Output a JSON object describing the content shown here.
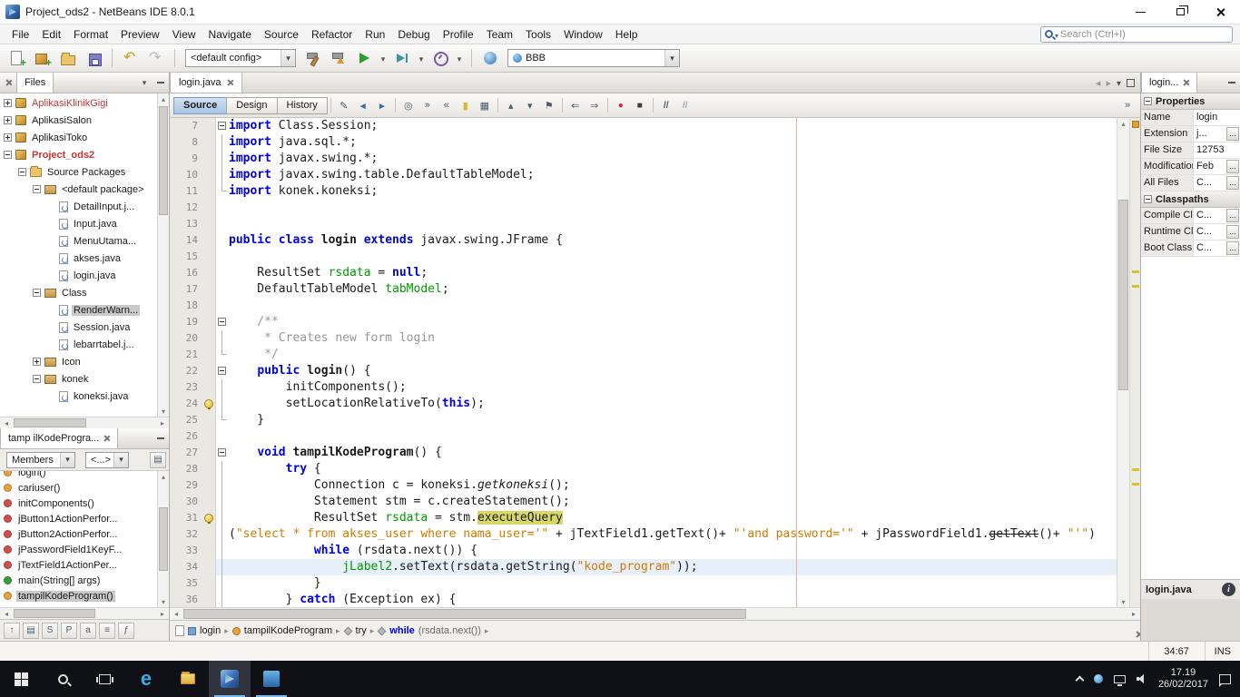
{
  "window": {
    "title": "Project_ods2 - NetBeans IDE 8.0.1"
  },
  "menubar": {
    "items": [
      "File",
      "Edit",
      "Format",
      "Preview",
      "View",
      "Navigate",
      "Source",
      "Refactor",
      "Run",
      "Debug",
      "Profile",
      "Team",
      "Tools",
      "Window",
      "Help"
    ],
    "search_placeholder": "Search (Ctrl+I)"
  },
  "toolbar": {
    "items": [
      "new-file",
      "new-project",
      "open-project",
      "save-all",
      "|",
      "undo",
      "redo",
      "|",
      "config-combo",
      "build",
      "clean-build",
      "run",
      "run-dropdown",
      "debug",
      "debug-dropdown",
      "profile",
      "profile-dropdown",
      "|",
      "profile-point",
      "memory-combo"
    ],
    "config_value": "<default config>",
    "memory_value": "BBB"
  },
  "files_panel": {
    "tab": "Files",
    "tree": [
      {
        "label": "AplikasiKlinikGigi",
        "level": 0,
        "icon": "project",
        "handle": "plus",
        "labelColor": "#cc3333"
      },
      {
        "label": "AplikasiSalon",
        "level": 0,
        "icon": "project",
        "handle": "plus"
      },
      {
        "label": "AplikasiToko",
        "level": 0,
        "icon": "project",
        "handle": "plus"
      },
      {
        "label": "Project_ods2",
        "level": 0,
        "icon": "project",
        "handle": "minus",
        "labelColor": "#cc3333",
        "bold": true
      },
      {
        "label": "Source Packages",
        "level": 1,
        "icon": "folder",
        "handle": "minus"
      },
      {
        "label": "<default package>",
        "level": 2,
        "icon": "package",
        "handle": "minus"
      },
      {
        "label": "DetailInput.j...",
        "level": 3,
        "icon": "java"
      },
      {
        "label": "Input.java",
        "level": 3,
        "icon": "java"
      },
      {
        "label": "MenuUtama...",
        "level": 3,
        "icon": "java"
      },
      {
        "label": "akses.java",
        "level": 3,
        "icon": "java"
      },
      {
        "label": "login.java",
        "level": 3,
        "icon": "java"
      },
      {
        "label": "Class",
        "level": 2,
        "icon": "package",
        "handle": "minus"
      },
      {
        "label": "RenderWarn...",
        "level": 3,
        "icon": "java",
        "selected": true
      },
      {
        "label": "Session.java",
        "level": 3,
        "icon": "java"
      },
      {
        "label": "lebarrtabel.j...",
        "level": 3,
        "icon": "java"
      },
      {
        "label": "Icon",
        "level": 2,
        "icon": "package",
        "handle": "plus"
      },
      {
        "label": "konek",
        "level": 2,
        "icon": "package",
        "handle": "minus"
      },
      {
        "label": "koneksi.java",
        "level": 3,
        "icon": "java"
      }
    ]
  },
  "navigator_panel": {
    "tab": "tamp ilKodeProgra...",
    "filter_combo": "Members",
    "filter_combo2": "<...>",
    "items": [
      {
        "label": "login()",
        "clipped": true,
        "color": "#e8a33d"
      },
      {
        "label": "cariuser()",
        "color": "#e8a33d"
      },
      {
        "label": "initComponents()",
        "color": "#d05050"
      },
      {
        "label": "jButton1ActionPerfor...",
        "color": "#d05050"
      },
      {
        "label": "jButton2ActionPerfor...",
        "color": "#d05050"
      },
      {
        "label": "jPasswordField1KeyF...",
        "color": "#d05050"
      },
      {
        "label": "jTextField1ActionPer...",
        "color": "#d05050"
      },
      {
        "label": "main(String[] args)",
        "color": "#3a9e3a"
      },
      {
        "label": "tampilKodeProgram()",
        "color": "#e8a33d",
        "selected": true
      }
    ],
    "filter_icons": [
      "show-inherited",
      "show-fields",
      "show-static",
      "show-non-public",
      "sort-alpha",
      "sort-source",
      "show-fqn"
    ]
  },
  "editor": {
    "tab": "login.java",
    "view_tabs": [
      "Source",
      "Design",
      "History"
    ],
    "toolbar_icons": [
      "last-edit",
      "back",
      "forward",
      "|",
      "find-selection",
      "find-next",
      "find-previous",
      "toggle-highlight",
      "rectangular-selection",
      "|",
      "previous-bookmark",
      "next-bookmark",
      "toggle-bookmark",
      "|",
      "shift-left",
      "shift-right",
      "|",
      "start-macro-recording",
      "stop-macro-recording",
      "|",
      "comment",
      "uncomment"
    ],
    "code": [
      {
        "n": 7,
        "fold": "box",
        "t": [
          [
            "k",
            "import"
          ],
          [
            "p",
            " Class.Session;"
          ]
        ]
      },
      {
        "n": 8,
        "fold": "line",
        "t": [
          [
            "k",
            "import"
          ],
          [
            "p",
            " java.sql.*;"
          ]
        ]
      },
      {
        "n": 9,
        "fold": "line",
        "t": [
          [
            "k",
            "import"
          ],
          [
            "p",
            " javax.swing.*;"
          ]
        ]
      },
      {
        "n": 10,
        "fold": "line",
        "t": [
          [
            "k",
            "import"
          ],
          [
            "p",
            " javax.swing.table.DefaultTableModel;"
          ]
        ]
      },
      {
        "n": 11,
        "fold": "end",
        "t": [
          [
            "k",
            "import"
          ],
          [
            "p",
            " konek.koneksi;"
          ]
        ]
      },
      {
        "n": 12,
        "t": []
      },
      {
        "n": 13,
        "t": []
      },
      {
        "n": 14,
        "t": [
          [
            "k",
            "public"
          ],
          [
            "p",
            " "
          ],
          [
            "k",
            "class"
          ],
          [
            "p",
            " "
          ],
          [
            "b",
            "login"
          ],
          [
            "p",
            " "
          ],
          [
            "k",
            "extends"
          ],
          [
            "p",
            " javax.swing.JFrame {"
          ]
        ]
      },
      {
        "n": 15,
        "t": []
      },
      {
        "n": 16,
        "t": [
          [
            "p",
            "    ResultSet "
          ],
          [
            "f",
            "rsdata"
          ],
          [
            "p",
            " = "
          ],
          [
            "k",
            "null"
          ],
          [
            "p",
            ";"
          ]
        ]
      },
      {
        "n": 17,
        "t": [
          [
            "p",
            "    DefaultTableModel "
          ],
          [
            "f",
            "tabModel"
          ],
          [
            "p",
            ";"
          ]
        ]
      },
      {
        "n": 18,
        "t": []
      },
      {
        "n": 19,
        "fold": "box",
        "t": [
          [
            "c",
            "    /**"
          ]
        ]
      },
      {
        "n": 20,
        "fold": "line",
        "t": [
          [
            "c",
            "     * Creates new form login"
          ]
        ]
      },
      {
        "n": 21,
        "fold": "end",
        "t": [
          [
            "c",
            "     */"
          ]
        ]
      },
      {
        "n": 22,
        "fold": "box",
        "t": [
          [
            "p",
            "    "
          ],
          [
            "k",
            "public"
          ],
          [
            "p",
            " "
          ],
          [
            "b",
            "login"
          ],
          [
            "p",
            "() {"
          ]
        ]
      },
      {
        "n": 23,
        "fold": "line",
        "t": [
          [
            "p",
            "        initComponents();"
          ]
        ]
      },
      {
        "n": 24,
        "fold": "line",
        "ann": "bulb",
        "t": [
          [
            "p",
            "        setLocationRelativeTo("
          ],
          [
            "k",
            "this"
          ],
          [
            "p",
            ");"
          ]
        ]
      },
      {
        "n": 25,
        "fold": "end",
        "t": [
          [
            "p",
            "    }"
          ]
        ]
      },
      {
        "n": 26,
        "t": []
      },
      {
        "n": 27,
        "fold": "box",
        "t": [
          [
            "p",
            "    "
          ],
          [
            "k",
            "void"
          ],
          [
            "p",
            " "
          ],
          [
            "b",
            "tampilKodeProgram"
          ],
          [
            "p",
            "() {"
          ]
        ]
      },
      {
        "n": 28,
        "fold": "line",
        "t": [
          [
            "p",
            "        "
          ],
          [
            "k",
            "try"
          ],
          [
            "p",
            " {"
          ]
        ]
      },
      {
        "n": 29,
        "fold": "line",
        "t": [
          [
            "p",
            "            Connection c = koneksi."
          ],
          [
            "i",
            "getkoneksi"
          ],
          [
            "p",
            "();"
          ]
        ]
      },
      {
        "n": 30,
        "fold": "line",
        "t": [
          [
            "p",
            "            Statement stm = c.createStatement();"
          ]
        ]
      },
      {
        "n": 31,
        "fold": "line",
        "ann": "bulb",
        "t": [
          [
            "p",
            "            ResultSet "
          ],
          [
            "f",
            "rsdata"
          ],
          [
            "p",
            " = stm."
          ],
          [
            "h",
            "executeQuery"
          ]
        ]
      },
      {
        "n": 32,
        "fold": "line",
        "t": [
          [
            "p",
            "("
          ],
          [
            "s",
            "\"select * from akses_user where nama_user='\""
          ],
          [
            "p",
            " + jTextField1.getText()+ "
          ],
          [
            "s",
            "\"'and password='\""
          ],
          [
            "p",
            " + jPasswordField1."
          ],
          [
            "x",
            "getText"
          ],
          [
            "p",
            "()+ "
          ],
          [
            "s",
            "\"'\""
          ],
          [
            "p",
            ")"
          ]
        ]
      },
      {
        "n": 33,
        "fold": "line",
        "t": [
          [
            "p",
            "            "
          ],
          [
            "k",
            "while"
          ],
          [
            "p",
            " (rsdata.next()) {"
          ]
        ]
      },
      {
        "n": 34,
        "fold": "line",
        "cur": true,
        "t": [
          [
            "p",
            "                "
          ],
          [
            "f",
            "jLabel2"
          ],
          [
            "p",
            ".setText(rsdata.getString("
          ],
          [
            "s",
            "\"kode_program\""
          ],
          [
            "p",
            "));"
          ]
        ]
      },
      {
        "n": 35,
        "fold": "line",
        "t": [
          [
            "p",
            "            }"
          ]
        ]
      },
      {
        "n": 36,
        "fold": "line",
        "t": [
          [
            "p",
            "        } "
          ],
          [
            "k",
            "catch"
          ],
          [
            "p",
            " (Exception ex) {"
          ]
        ]
      }
    ],
    "breadcrumb": [
      {
        "label": "login",
        "icon": "class"
      },
      {
        "label": "tampilKodeProgram",
        "icon": "method"
      },
      {
        "label": "try",
        "icon": "block"
      },
      {
        "label": "while (rsdata.next())",
        "icon": "block",
        "kw": "while",
        "rest": " (rsdata.next())"
      }
    ]
  },
  "properties_panel": {
    "tab": "login...",
    "sections": [
      {
        "title": "Properties",
        "rows": [
          {
            "label": "Name",
            "value": "login",
            "button": false
          },
          {
            "label": "Extension",
            "value": "j...",
            "button": true
          },
          {
            "label": "File Size",
            "value": "12753",
            "button": false
          },
          {
            "label": "Modification",
            "value": "Feb",
            "button": true
          },
          {
            "label": "All Files",
            "value": "C...",
            "button": true
          }
        ]
      },
      {
        "title": "Classpaths",
        "rows": [
          {
            "label": "Compile Clas...",
            "value": "C...",
            "button": true
          },
          {
            "label": "Runtime Clas...",
            "value": "C...",
            "button": true
          },
          {
            "label": "Boot Classp...",
            "value": "C...",
            "button": true
          }
        ]
      }
    ],
    "footer": "login.java"
  },
  "statusbar": {
    "caret": "34:67",
    "mode": "INS"
  },
  "taskbar": {
    "time": "17.19",
    "date": "26/02/2017"
  }
}
